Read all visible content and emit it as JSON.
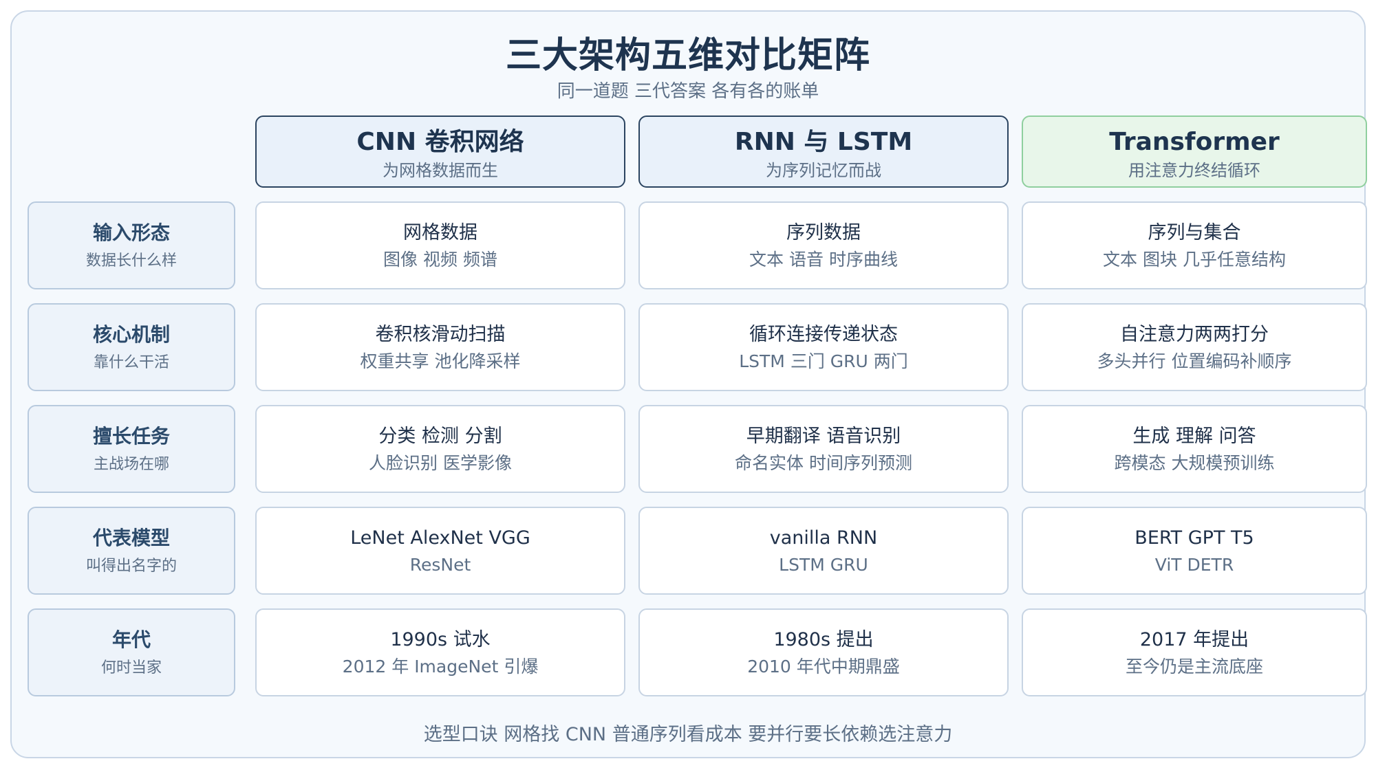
{
  "title": "三大架构五维对比矩阵",
  "subtitle": "同一道题 三代答案 各有各的账单",
  "columns": [
    {
      "name": "CNN 卷积网络",
      "tagline": "为网格数据而生"
    },
    {
      "name": "RNN 与 LSTM",
      "tagline": "为序列记忆而战"
    },
    {
      "name": "Transformer",
      "tagline": "用注意力终结循环"
    }
  ],
  "rows": [
    {
      "name": "输入形态",
      "tagline": "数据长什么样",
      "cells": [
        {
          "main": "网格数据",
          "sub": "图像 视频 频谱"
        },
        {
          "main": "序列数据",
          "sub": "文本 语音 时序曲线"
        },
        {
          "main": "序列与集合",
          "sub": "文本 图块 几乎任意结构"
        }
      ]
    },
    {
      "name": "核心机制",
      "tagline": "靠什么干活",
      "cells": [
        {
          "main": "卷积核滑动扫描",
          "sub": "权重共享 池化降采样"
        },
        {
          "main": "循环连接传递状态",
          "sub": "LSTM 三门 GRU 两门"
        },
        {
          "main": "自注意力两两打分",
          "sub": "多头并行 位置编码补顺序"
        }
      ]
    },
    {
      "name": "擅长任务",
      "tagline": "主战场在哪",
      "cells": [
        {
          "main": "分类 检测 分割",
          "sub": "人脸识别 医学影像"
        },
        {
          "main": "早期翻译 语音识别",
          "sub": "命名实体 时间序列预测"
        },
        {
          "main": "生成 理解 问答",
          "sub": "跨模态 大规模预训练"
        }
      ]
    },
    {
      "name": "代表模型",
      "tagline": "叫得出名字的",
      "cells": [
        {
          "main": "LeNet AlexNet VGG",
          "sub": "ResNet"
        },
        {
          "main": "vanilla RNN",
          "sub": "LSTM GRU"
        },
        {
          "main": "BERT GPT T5",
          "sub": "ViT DETR"
        }
      ]
    },
    {
      "name": "年代",
      "tagline": "何时当家",
      "cells": [
        {
          "main": "1990s 试水",
          "sub": "2012 年 ImageNet 引爆"
        },
        {
          "main": "1980s 提出",
          "sub": "2010 年代中期鼎盛"
        },
        {
          "main": "2017 年提出",
          "sub": "至今仍是主流底座"
        }
      ]
    }
  ],
  "footer": "选型口诀 网格找 CNN 普通序列看成本 要并行要长依赖选注意力",
  "colors": {
    "accent": "#1e344f",
    "muted": "#5c6f86",
    "highlight_green": "#8fcf9e"
  }
}
